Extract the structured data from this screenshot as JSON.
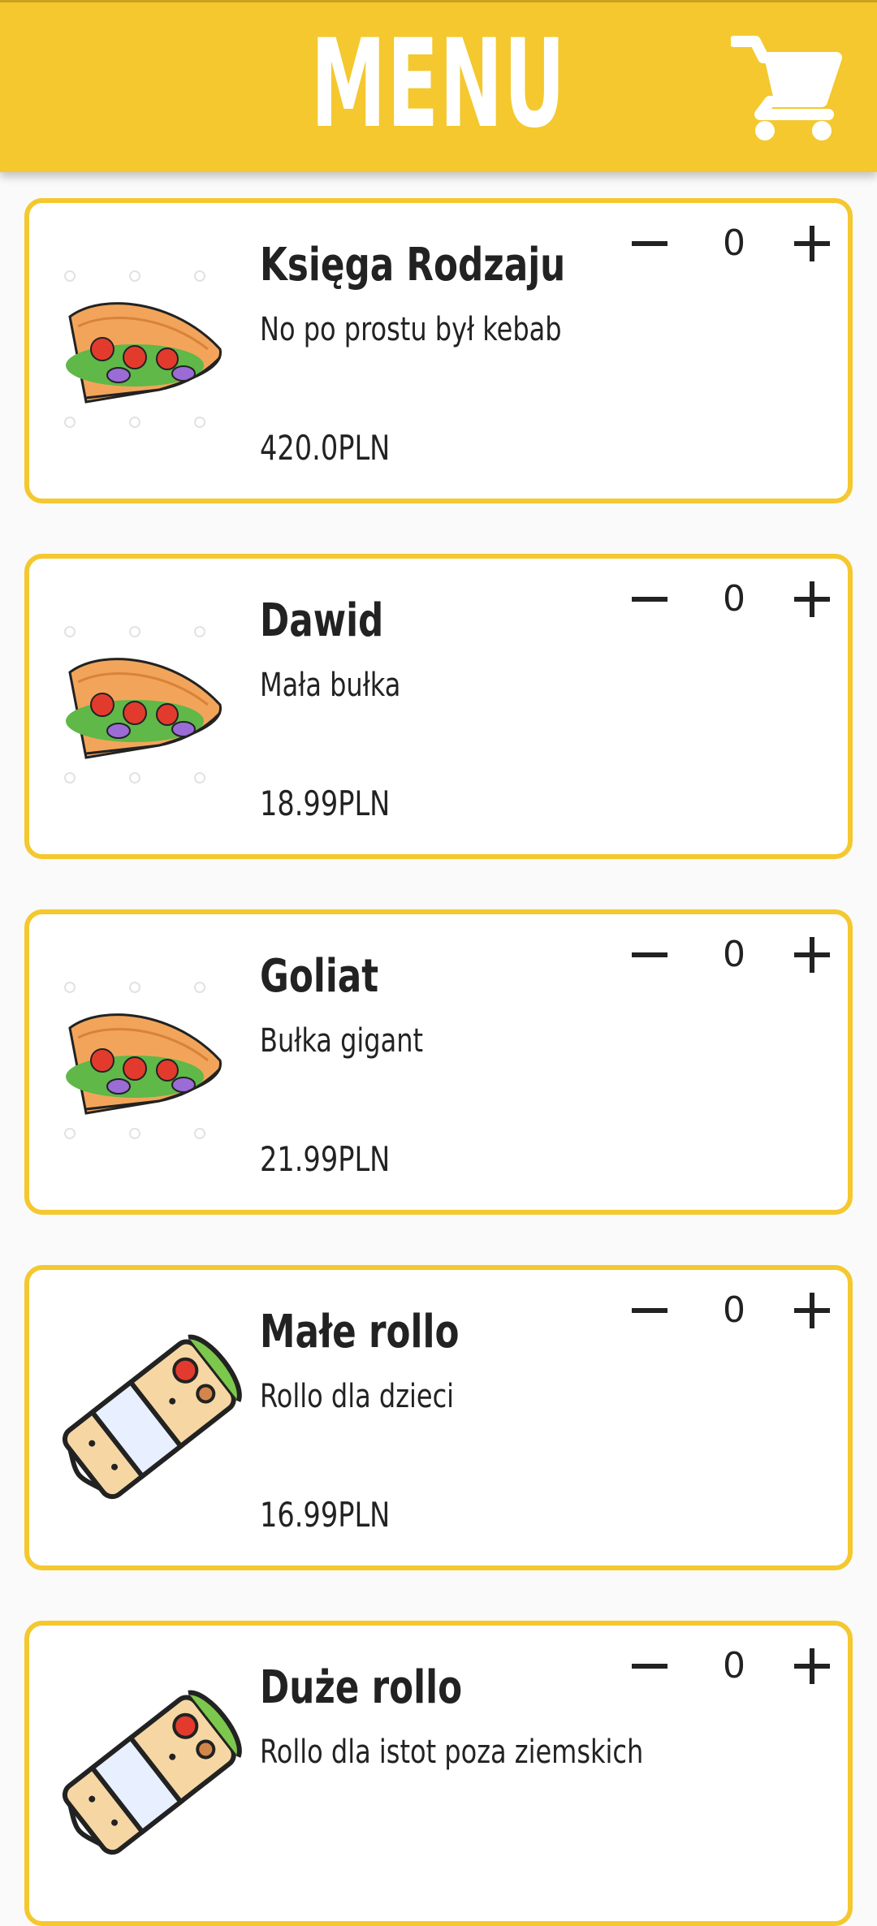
{
  "header": {
    "title": "MENU",
    "cart_icon": "shopping-cart-icon",
    "background_color": "#f4c82e"
  },
  "colors": {
    "accent": "#f4c82e",
    "text": "#222222",
    "card_background": "#ffffff",
    "page_background": "#fafafa"
  },
  "items": [
    {
      "name": "Księga Rodzaju",
      "description": "No po prostu był kebab",
      "price": "420.0PLN",
      "quantity": "0",
      "image_icon": "kebab-pita-icon"
    },
    {
      "name": "Dawid",
      "description": "Mała bułka",
      "price": "18.99PLN",
      "quantity": "0",
      "image_icon": "kebab-pita-icon"
    },
    {
      "name": "Goliat",
      "description": "Bułka gigant",
      "price": "21.99PLN",
      "quantity": "0",
      "image_icon": "kebab-pita-icon"
    },
    {
      "name": "Małe rollo",
      "description": "Rollo dla dzieci",
      "price": "16.99PLN",
      "quantity": "0",
      "image_icon": "wrap-roll-icon"
    },
    {
      "name": "Duże rollo",
      "description": "Rollo dla istot poza ziemskich",
      "price": "",
      "quantity": "0",
      "image_icon": "wrap-roll-icon"
    }
  ]
}
